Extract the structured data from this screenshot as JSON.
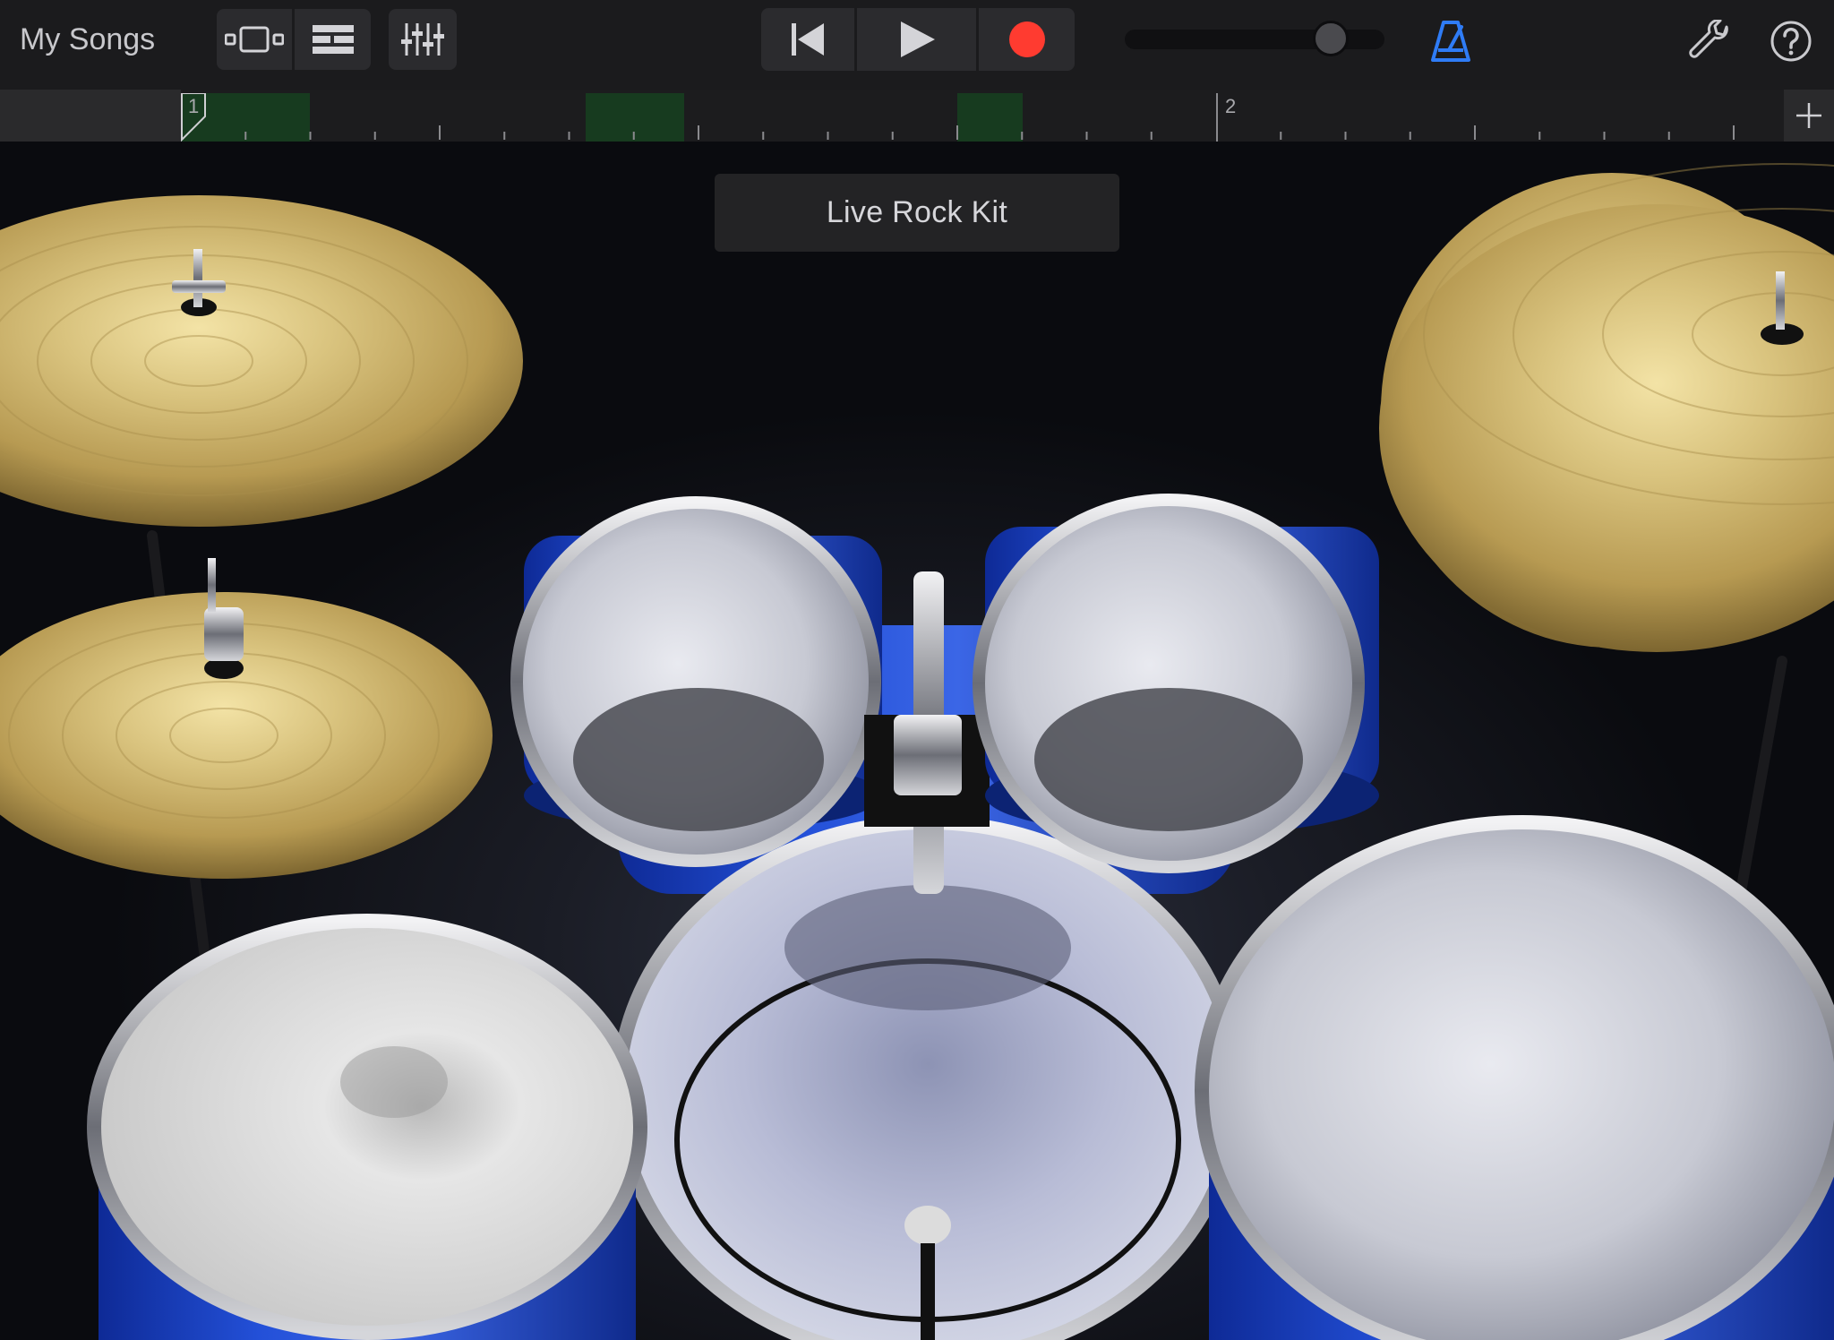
{
  "toolbar": {
    "my_songs": "My Songs",
    "view_buttons": [
      "instrument-view",
      "tracks-view"
    ],
    "icons": {
      "browser": "instrument-browser-icon",
      "tracks": "tracks-view-icon",
      "mixer": "track-controls-icon",
      "rewind": "go-to-beginning-icon",
      "play": "play-icon",
      "record": "record-icon",
      "metronome": "metronome-icon",
      "settings": "wrench-icon",
      "help": "help-icon"
    },
    "master_volume": 0.76,
    "metronome_on": true
  },
  "ruler": {
    "bars": [
      "1",
      "2"
    ],
    "add_icon": "plus-icon"
  },
  "instrument": {
    "kit_name": "Live Rock Kit"
  },
  "colors": {
    "record": "#ff3b30",
    "metronome": "#2f7cf6",
    "region": "#173b1f",
    "shell_blue": "#1f46c8",
    "cymbal_gold": "#d8c17a"
  }
}
